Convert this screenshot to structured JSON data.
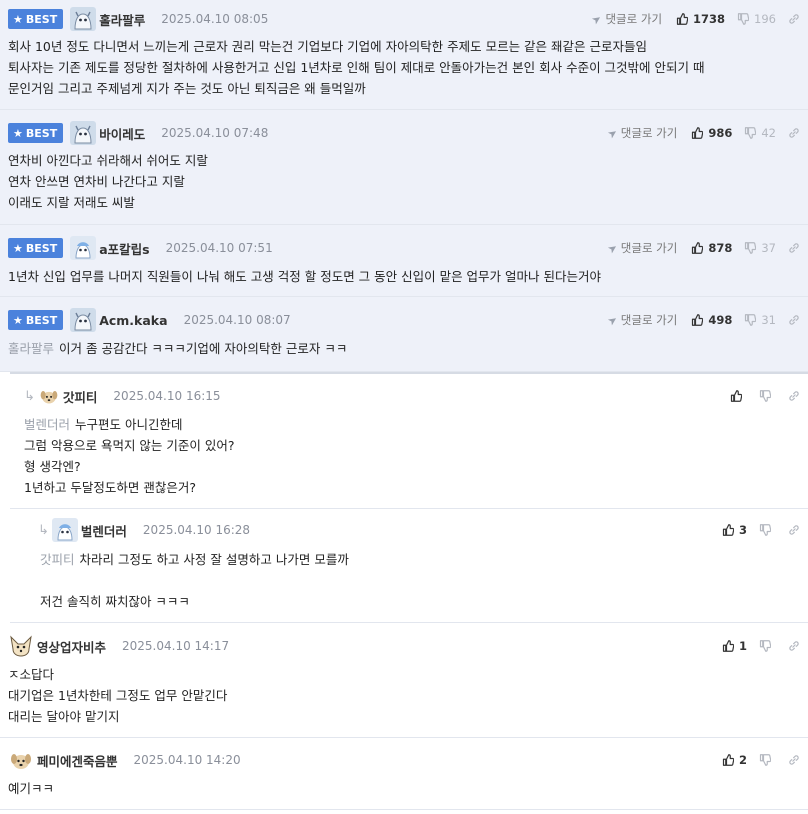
{
  "ui": {
    "best_label": "BEST",
    "goto_label": "댓글로 가기"
  },
  "comments": [
    {
      "nick": "홀라팔루",
      "date": "2025.04.10 08:05",
      "likes": "1738",
      "dislikes": "196",
      "lines": [
        "회사 10년 정도 다니면서 느끼는게 근로자 권리 막는건 기업보다 기업에 자아의탁한 주제도 모르는 같은 좨같은 근로자들임",
        "퇴사자는 기존 제도를 정당한 절차하에 사용한거고 신입 1년차로 인해 팀이 제대로 안돌아가는건 본인 회사 수준이 그것밖에 안되기 때",
        "문인거임 그리고 주제넘게 지가 주는 것도 아닌 퇴직금은 왜 들먹일까"
      ]
    },
    {
      "nick": "바이레도",
      "date": "2025.04.10 07:48",
      "likes": "986",
      "dislikes": "42",
      "lines": [
        "연차비 아낀다고 쉬라해서 쉬어도 지랄",
        "연차 안쓰면 연차비 나간다고 지랄",
        "이래도 지랄 저래도 씨발"
      ]
    },
    {
      "nick": "a포칼립s",
      "date": "2025.04.10 07:51",
      "likes": "878",
      "dislikes": "37",
      "lines": [
        "1년차 신입 업무를 나머지 직원들이 나눠 해도 고생 걱정 할 정도면 그 동안 신입이 맡은 업무가 얼마나 된다는거야"
      ]
    },
    {
      "nick": "Acm.kaka",
      "date": "2025.04.10 08:07",
      "likes": "498",
      "dislikes": "31",
      "quote": "홀라팔루",
      "lines": [
        "이거 좀 공감간다 ㅋㅋㅋ기업에 자아의탁한 근로자 ㅋㅋ"
      ]
    },
    {
      "nick": "갓피티",
      "date": "2025.04.10 16:15",
      "likes": "",
      "quote": "벌렌더러",
      "lines": [
        "누구편도 아니긴한데",
        "그럼 악용으로 욕먹지 않는 기준이 있어?",
        "형 생각엔?",
        "1년하고 두달정도하면 괜찮은거?"
      ]
    },
    {
      "nick": "벌렌더러",
      "date": "2025.04.10 16:28",
      "likes": "3",
      "quote": "갓피티",
      "lines": [
        "차라리 그정도 하고 사정 잘 설명하고 나가면 모를까",
        "저건 솔직히 짜치잖아 ㅋㅋㅋ"
      ]
    },
    {
      "nick": "영상업자비추",
      "date": "2025.04.10 14:17",
      "likes": "1",
      "lines": [
        "ㅈ소답다",
        "대기업은 1년차한테 그정도 업무 안맡긴다",
        "대리는 달아야 맡기지"
      ]
    },
    {
      "nick": "페미에겐죽음뿐",
      "date": "2025.04.10 14:20",
      "likes": "2",
      "lines": [
        "예기ㅋㅋ"
      ]
    }
  ]
}
